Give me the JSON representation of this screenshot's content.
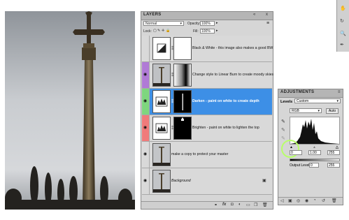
{
  "layers_panel": {
    "tab": "LAYERS",
    "tab_controls": {
      "minimize": "«",
      "close": "x",
      "menu": "≡"
    },
    "blend_mode": "Normal",
    "opacity_label": "Opacity:",
    "opacity_value": "100%",
    "lock_label": "Lock:",
    "fill_label": "Fill:",
    "fill_value": "100%",
    "layers": [
      {
        "name": "Black & White - this image also makes a good BW",
        "visible": false,
        "color_tag": "none"
      },
      {
        "name": "Change style to Linear Burn to create moody skies",
        "visible": true,
        "color_tag": "#b07ad6"
      },
      {
        "name": "Darken - paint on white to create depth",
        "visible": true,
        "color_tag": "#7ed67e",
        "selected": true
      },
      {
        "name": "Brighten - paint on white to lighten the top",
        "visible": true,
        "color_tag": "#f07a7a"
      },
      {
        "name": "make a copy to protect your master",
        "visible": true,
        "color_tag": "none"
      },
      {
        "name": "Background",
        "visible": true,
        "color_tag": "none",
        "italic": true,
        "locked": true
      }
    ],
    "bottom_icons": [
      "link-icon",
      "fx-icon",
      "mask-icon",
      "adjustment-icon",
      "folder-icon",
      "new-layer-icon",
      "trash-icon"
    ]
  },
  "adjustments_panel": {
    "tab": "ADJUSTMENTS",
    "title": "Levels",
    "preset": "Custom",
    "channel": "RGB",
    "auto_label": "Auto",
    "input_black": "0",
    "input_gamma": "1.00",
    "input_white": "255",
    "output_label": "Output Levels:",
    "output_black": "0",
    "output_white": "255"
  },
  "colors": {
    "selected_row": "#3d8fe6",
    "panel_bg": "#d6d6d6",
    "tab_bg": "#b5b5b5",
    "highlight_circle": "#b8ff6a"
  }
}
